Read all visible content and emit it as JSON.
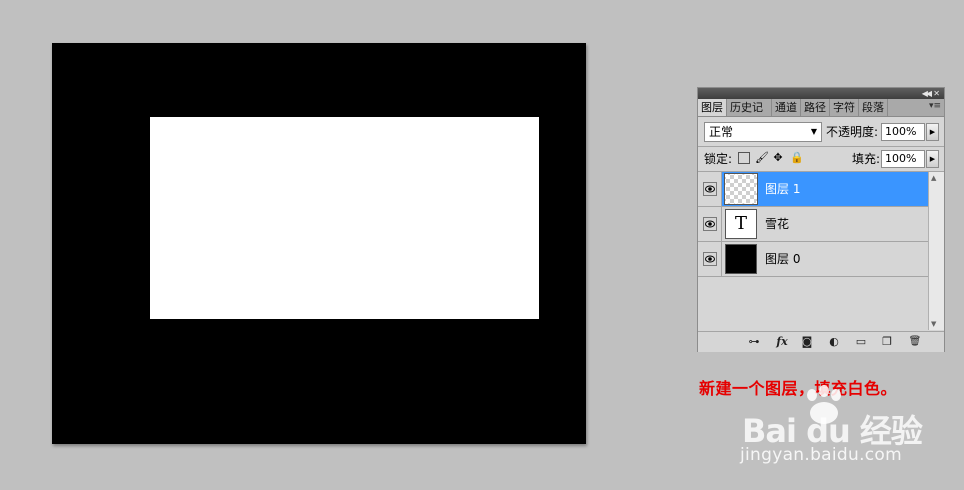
{
  "canvas": {
    "background": "#000000",
    "fill_color": "#ffffff"
  },
  "panel": {
    "tabs": [
      {
        "label": "图层",
        "active": true
      },
      {
        "label": "历史记",
        "active": false
      },
      {
        "label": "通道",
        "active": false
      },
      {
        "label": "路径",
        "active": false
      },
      {
        "label": "字符",
        "active": false
      },
      {
        "label": "段落",
        "active": false
      }
    ],
    "blend_mode": "正常",
    "opacity_label": "不透明度:",
    "opacity_value": "100%",
    "lock_label": "锁定:",
    "fill_label": "填充:",
    "fill_value": "100%",
    "layers": [
      {
        "name": "图层 1",
        "thumb": "checker",
        "selected": true
      },
      {
        "name": "雪花",
        "thumb": "text",
        "thumb_glyph": "T",
        "selected": false
      },
      {
        "name": "图层 0",
        "thumb": "black",
        "selected": false
      }
    ],
    "bottom_tools": [
      {
        "icon": "link-layers-icon",
        "glyph": "⊶"
      },
      {
        "icon": "fx-icon",
        "glyph": "fx"
      },
      {
        "icon": "mask-icon",
        "glyph": "◙"
      },
      {
        "icon": "adjustment-icon",
        "glyph": "◐"
      },
      {
        "icon": "group-folder-icon",
        "glyph": "▭"
      },
      {
        "icon": "new-layer-icon",
        "glyph": "❐"
      },
      {
        "icon": "trash-icon",
        "glyph": "🗑"
      }
    ],
    "selected_color": "#3a95ff"
  },
  "caption": "新建一个图层，填充白色。",
  "watermark": {
    "logo": "Bai du 经验",
    "url": "jingyan.baidu.com"
  }
}
